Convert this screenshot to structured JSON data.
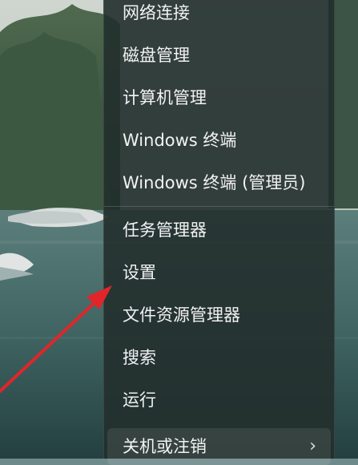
{
  "context_menu": {
    "groups": [
      {
        "items": [
          {
            "label": "网络连接"
          },
          {
            "label": "磁盘管理"
          },
          {
            "label": "计算机管理"
          },
          {
            "label": "Windows 终端"
          },
          {
            "label": "Windows 终端 (管理员)"
          }
        ]
      },
      {
        "items": [
          {
            "label": "任务管理器"
          },
          {
            "label": "设置"
          },
          {
            "label": "文件资源管理器"
          },
          {
            "label": "搜索"
          },
          {
            "label": "运行"
          },
          {
            "label": "关机或注销",
            "has_submenu": true,
            "icon": "chevron-right-icon"
          }
        ]
      }
    ]
  },
  "annotation": {
    "arrow_color": "#e0262a",
    "target": "设置"
  },
  "colors": {
    "menu_bg": "#222f2c",
    "text": "#f2f2f2",
    "water": "#3f6462"
  }
}
